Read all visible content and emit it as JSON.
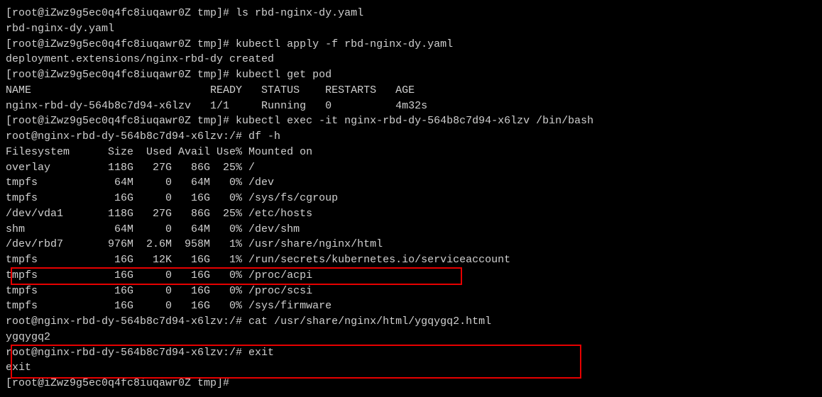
{
  "lines": {
    "l1": "[root@iZwz9g5ec0q4fc8iuqawr0Z tmp]# ls rbd-nginx-dy.yaml",
    "l2": "rbd-nginx-dy.yaml",
    "l3": "[root@iZwz9g5ec0q4fc8iuqawr0Z tmp]# kubectl apply -f rbd-nginx-dy.yaml",
    "l4": "deployment.extensions/nginx-rbd-dy created",
    "l5": "[root@iZwz9g5ec0q4fc8iuqawr0Z tmp]# kubectl get pod",
    "l6": "NAME                            READY   STATUS    RESTARTS   AGE",
    "l7": "nginx-rbd-dy-564b8c7d94-x6lzv   1/1     Running   0          4m32s",
    "l8": "[root@iZwz9g5ec0q4fc8iuqawr0Z tmp]# kubectl exec -it nginx-rbd-dy-564b8c7d94-x6lzv /bin/bash",
    "l9": "root@nginx-rbd-dy-564b8c7d94-x6lzv:/# df -h",
    "l10": "Filesystem      Size  Used Avail Use% Mounted on",
    "l11": "overlay         118G   27G   86G  25% /",
    "l12": "tmpfs            64M     0   64M   0% /dev",
    "l13": "tmpfs            16G     0   16G   0% /sys/fs/cgroup",
    "l14": "/dev/vda1       118G   27G   86G  25% /etc/hosts",
    "l15": "shm              64M     0   64M   0% /dev/shm",
    "l16": "/dev/rbd7       976M  2.6M  958M   1% /usr/share/nginx/html",
    "l17": "tmpfs            16G   12K   16G   1% /run/secrets/kubernetes.io/serviceaccount",
    "l18": "tmpfs            16G     0   16G   0% /proc/acpi",
    "l19": "tmpfs            16G     0   16G   0% /proc/scsi",
    "l20": "tmpfs            16G     0   16G   0% /sys/firmware",
    "l21": "root@nginx-rbd-dy-564b8c7d94-x6lzv:/# cat /usr/share/nginx/html/ygqygq2.html",
    "l22": "ygqygq2",
    "l23": "root@nginx-rbd-dy-564b8c7d94-x6lzv:/# exit",
    "l24": "exit",
    "l25": "[root@iZwz9g5ec0q4fc8iuqawr0Z tmp]# "
  }
}
